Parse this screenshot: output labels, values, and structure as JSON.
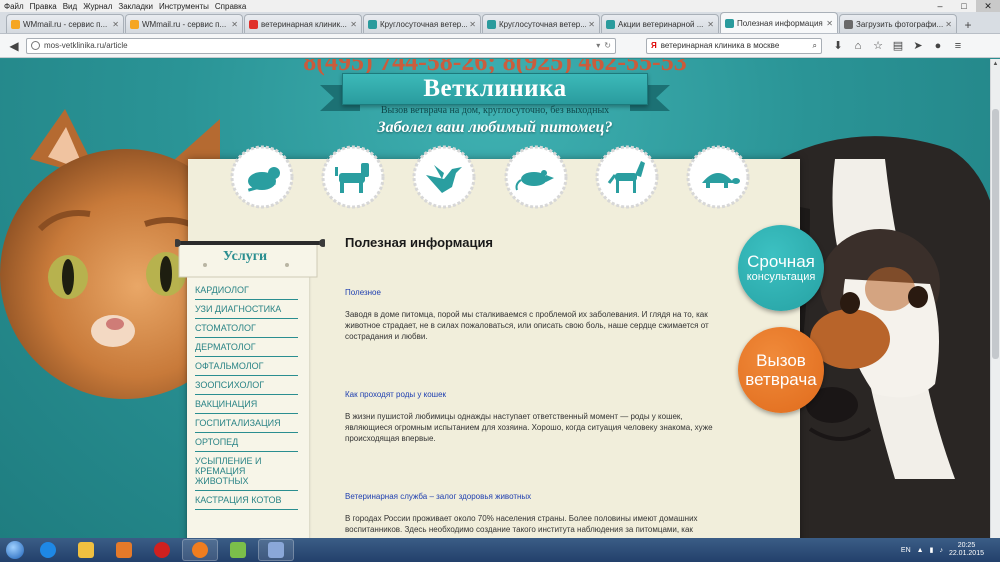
{
  "menubar": {
    "items": [
      "Файл",
      "Правка",
      "Вид",
      "Журнал",
      "Закладки",
      "Инструменты",
      "Справка"
    ],
    "window_controls": [
      "–",
      "□",
      "✕"
    ]
  },
  "tabs": [
    {
      "title": "WMmail.ru - сервис п...",
      "color": "#f5a623"
    },
    {
      "title": "WMmail.ru - сервис п...",
      "color": "#f5a623"
    },
    {
      "title": "ветеринарная клиник...",
      "color": "#e0312b"
    },
    {
      "title": "Круглосуточная ветер...",
      "color": "#2a9b9d"
    },
    {
      "title": "Круглосуточная ветер...",
      "color": "#2a9b9d"
    },
    {
      "title": "Акции ветеринарной ...",
      "color": "#2a9b9d"
    },
    {
      "title": "Полезная информация",
      "color": "#2a9b9d",
      "active": true
    },
    {
      "title": "Загрузить фотографи...",
      "color": "#6a6a6a"
    }
  ],
  "navbar": {
    "url": "mos-vetklinika.ru/article",
    "search_query": "ветеринарная клиника в москве",
    "search_engine": "Я"
  },
  "page": {
    "phone": "8(495) 744-58-26; 8(925) 462-55-53",
    "logo": "Ветклиника",
    "tagline": "Вызов ветврача на дом, круглосуточно, без выходных",
    "headline": "Заболел ваш любимый питомец?",
    "badges": [
      "rodent-icon",
      "dog-icon",
      "bird-icon",
      "rat-icon",
      "horse-icon",
      "turtle-icon"
    ],
    "sidebar": {
      "title": "Услуги",
      "items": [
        "Кардиолог",
        "УЗИ диагностика",
        "Стоматолог",
        "Дерматолог",
        "Офтальмолог",
        "Зоопсихолог",
        "Вакцинация",
        "Госпитализация",
        "Ортопед",
        "Усыпление и кремация животных",
        "Кастрация котов"
      ]
    },
    "content": {
      "heading": "Полезная информация",
      "articles": [
        {
          "title": "Полезное",
          "text": "Заводя в доме питомца, порой мы сталкиваемся с проблемой их заболевания. И глядя на то, как животное страдает, не в силах пожаловаться, или описать свою боль, наше сердце сжимается от сострадания и любви."
        },
        {
          "title": "Как проходят роды у кошек",
          "text": "В жизни пушистой любимицы однажды наступает ответственный момент — роды у кошек, являющиеся огромным испытанием для хозяина. Хорошо, когда ситуация человеку знакома, хуже происходящая впервые."
        },
        {
          "title": "Ветеринарная служба – залог здоровья животных",
          "text": "В городах России проживает около 70% населения страны. Более половины имеют домашних воспитанников. Здесь необходимо создание такого института наблюдения за питомцами, как"
        }
      ]
    },
    "cta_urgent": {
      "line1": "Срочная",
      "line2": "консультация"
    },
    "cta_call": {
      "line1": "Вызов",
      "line2": "ветврача"
    }
  },
  "taskbar": {
    "apps": [
      "ie-icon",
      "explorer-icon",
      "media-player-icon",
      "opera-icon",
      "firefox-icon",
      "notepad-icon",
      "snipping-tool-icon"
    ],
    "lang": "EN",
    "time": "20:25",
    "date": "22.01.2015"
  },
  "colors": {
    "teal": "#2a8e90",
    "orange": "#e06b1c",
    "paper": "#f1eedb",
    "link": "#1f3fb0"
  }
}
